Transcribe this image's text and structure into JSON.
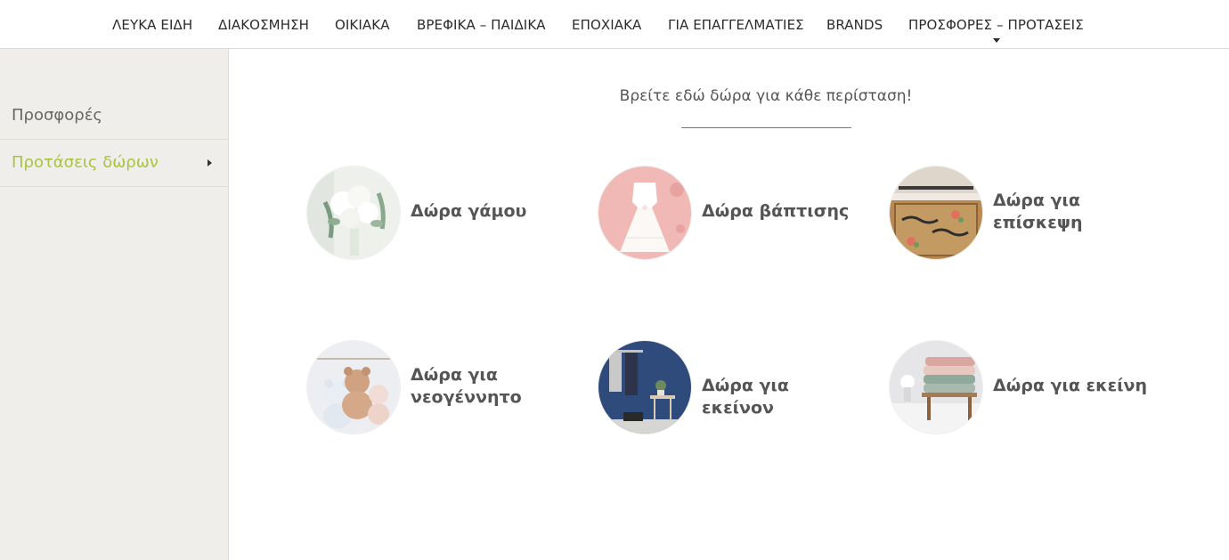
{
  "nav": {
    "items": [
      {
        "label": "ΛΕΥΚΑ ΕΙΔΗ"
      },
      {
        "label": "ΔΙΑΚΟΣΜΗΣΗ"
      },
      {
        "label": "ΟΙΚΙΑΚΑ"
      },
      {
        "label": "ΒΡΕΦΙΚΑ – ΠΑΙΔΙΚΑ"
      },
      {
        "label": "ΕΠΟΧΙΑΚΑ"
      },
      {
        "label": "ΓΙΑ ΕΠΑΓΓΕΛΜΑΤΙΕΣ"
      },
      {
        "label": "BRANDS"
      },
      {
        "label": "ΠΡΟΣΦΟΡΕΣ – ΠΡΟΤΑΣΕΙΣ"
      }
    ]
  },
  "sidebar": {
    "items": [
      {
        "label": "Προσφορές"
      },
      {
        "label": "Προτάσεις δώρων"
      }
    ],
    "active_color": "#a9c33c"
  },
  "main": {
    "intro": "Βρείτε εδώ δώρα για κάθε περίσταση!",
    "categories": [
      {
        "label": "Δώρα γάμου",
        "icon": "bouquet-image"
      },
      {
        "label": "Δώρα βάπτισης",
        "icon": "christening-dress-image"
      },
      {
        "label": "Δώρα για επίσκεψη",
        "icon": "doormat-image"
      },
      {
        "label": "Δώρα για νεογέννητο",
        "icon": "teddy-bears-image"
      },
      {
        "label": "Δώρα για εκείνον",
        "icon": "towels-blue-wall-image"
      },
      {
        "label": "Δώρα για εκείνη",
        "icon": "folded-towels-image"
      }
    ]
  }
}
